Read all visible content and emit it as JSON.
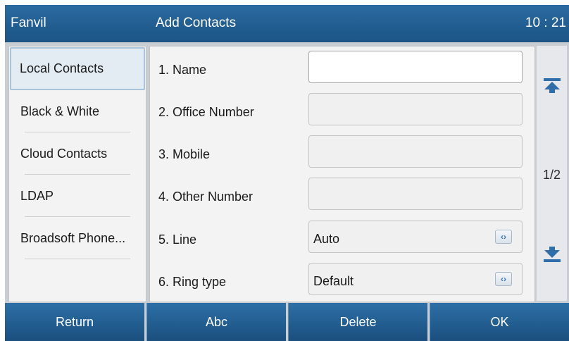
{
  "header": {
    "brand": "Fanvil",
    "title": "Add Contacts",
    "time": "10 : 21"
  },
  "sidebar": {
    "items": [
      {
        "label": "Local Contacts",
        "selected": true
      },
      {
        "label": "Black & White",
        "selected": false
      },
      {
        "label": "Cloud Contacts",
        "selected": false
      },
      {
        "label": "LDAP",
        "selected": false
      },
      {
        "label": "Broadsoft Phone...",
        "selected": false
      }
    ]
  },
  "form": {
    "fields": [
      {
        "label": "1. Name",
        "value": "",
        "type": "text",
        "focused": true
      },
      {
        "label": "2. Office Number",
        "value": "",
        "type": "text"
      },
      {
        "label": "3. Mobile",
        "value": "",
        "type": "text"
      },
      {
        "label": "4. Other Number",
        "value": "",
        "type": "text"
      },
      {
        "label": "5. Line",
        "value": "Auto",
        "type": "select"
      },
      {
        "label": "6. Ring type",
        "value": "Default",
        "type": "select"
      }
    ]
  },
  "scroller": {
    "page_indicator": "1/2",
    "up_icon": "scroll-top-icon",
    "down_icon": "scroll-bottom-icon"
  },
  "softkeys": {
    "return_label": "Return",
    "abc_label": "Abc",
    "delete_label": "Delete",
    "ok_label": "OK"
  },
  "colors": {
    "header_blue": "#1f5a8c",
    "softkey_blue": "#22609a",
    "selected_bg": "#e4ecf3",
    "background": "#c9ced4"
  }
}
